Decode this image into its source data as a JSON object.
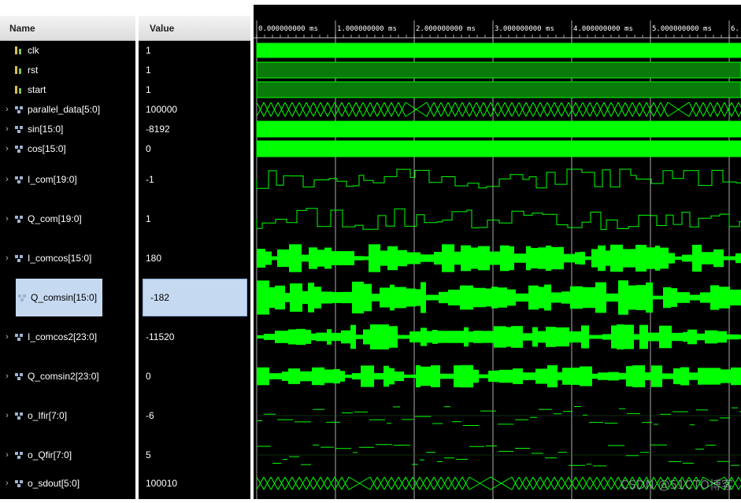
{
  "columns": {
    "name": "Name",
    "value": "Value"
  },
  "signals": [
    {
      "name": "clk",
      "value": "1",
      "kind": "bit"
    },
    {
      "name": "rst",
      "value": "1",
      "kind": "bit"
    },
    {
      "name": "start",
      "value": "1",
      "kind": "bit"
    },
    {
      "name": "parallel_data[5:0]",
      "value": "100000",
      "kind": "bus"
    },
    {
      "name": "sin[15:0]",
      "value": "-8192",
      "kind": "bus"
    },
    {
      "name": "cos[15:0]",
      "value": "0",
      "kind": "bus"
    },
    {
      "name": "I_com[19:0]",
      "value": "-1",
      "kind": "bus"
    },
    {
      "name": "Q_com[19:0]",
      "value": "1",
      "kind": "bus"
    },
    {
      "name": "I_comcos[15:0]",
      "value": "180",
      "kind": "bus"
    },
    {
      "name": "Q_comsin[15:0]",
      "value": "-182",
      "kind": "bus",
      "selected": true
    },
    {
      "name": "I_comcos2[23:0]",
      "value": "-11520",
      "kind": "bus"
    },
    {
      "name": "Q_comsin2[23:0]",
      "value": "0",
      "kind": "bus"
    },
    {
      "name": "o_Ifir[7:0]",
      "value": "-6",
      "kind": "bus"
    },
    {
      "name": "o_Qfir[7:0]",
      "value": "5",
      "kind": "bus"
    },
    {
      "name": "o_sdout[5:0]",
      "value": "100010",
      "kind": "bus"
    }
  ],
  "timeline": {
    "ticks": [
      "0.000000000 ms",
      "1.000000000 ms",
      "2.000000000 ms",
      "3.000000000 ms",
      "4.000000000 ms",
      "5.000000000 ms",
      "6."
    ]
  },
  "watermark": "CSDN @51CTO博客",
  "colors": {
    "wave": "#00ff00",
    "grid": "#ffffff",
    "selection": "#c5d9f1",
    "background": "#000000"
  }
}
